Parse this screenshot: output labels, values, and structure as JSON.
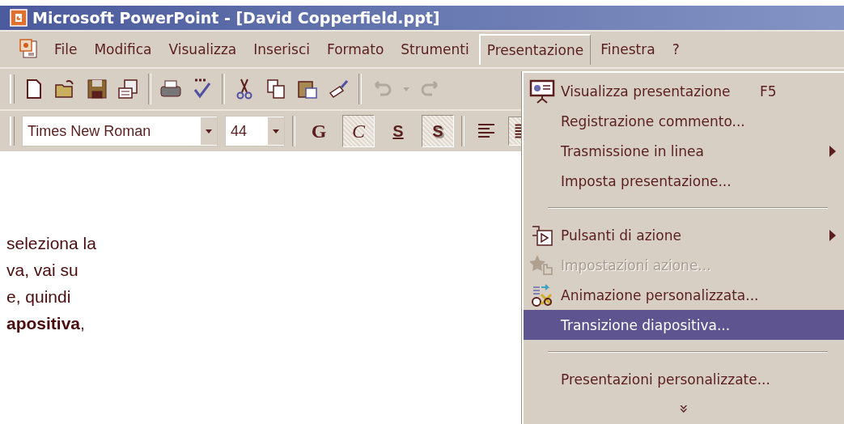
{
  "window": {
    "title": "Microsoft PowerPoint - [David Copperfield.ppt]"
  },
  "menu_bar": [
    {
      "label": "File",
      "selected": false
    },
    {
      "label": "Modifica",
      "selected": false
    },
    {
      "label": "Visualizza",
      "selected": false
    },
    {
      "label": "Inserisci",
      "selected": false
    },
    {
      "label": "Formato",
      "selected": false
    },
    {
      "label": "Strumenti",
      "selected": false
    },
    {
      "label": "Presentazione",
      "selected": true
    },
    {
      "label": "Finestra",
      "selected": false
    },
    {
      "label": "?",
      "selected": false
    }
  ],
  "standard_toolbar": [
    {
      "kind": "new",
      "disabled": false
    },
    {
      "kind": "open",
      "disabled": false
    },
    {
      "kind": "save",
      "disabled": false
    },
    {
      "kind": "mail",
      "disabled": false
    },
    {
      "kind": "separator"
    },
    {
      "kind": "print",
      "disabled": false
    },
    {
      "kind": "spelling",
      "disabled": false
    },
    {
      "kind": "separator"
    },
    {
      "kind": "cut",
      "disabled": false
    },
    {
      "kind": "copy",
      "disabled": false
    },
    {
      "kind": "paste",
      "disabled": false
    },
    {
      "kind": "painter",
      "disabled": false
    },
    {
      "kind": "separator"
    },
    {
      "kind": "undo",
      "disabled": true
    },
    {
      "kind": "dropdown",
      "disabled": true
    },
    {
      "kind": "redo",
      "disabled": true
    }
  ],
  "formatting_toolbar": {
    "font": "Times New Roman",
    "size": "44",
    "buttons": [
      {
        "kind": "bold",
        "label": "G",
        "on": false
      },
      {
        "kind": "italic",
        "label": "C",
        "on": true
      },
      {
        "kind": "underline",
        "label": "S",
        "on": false
      },
      {
        "kind": "shadow",
        "label": "S",
        "on": true
      },
      {
        "kind": "align-left",
        "on": false
      },
      {
        "kind": "align-center",
        "on": true
      }
    ]
  },
  "slide_text": [
    "seleziona la",
    "va, vai su",
    "e, quindi",
    "**apositiva**,"
  ],
  "dropdown_menu": [
    {
      "kind": "item",
      "label": "Visualizza presentazione",
      "shortcut": "F5",
      "submenu": false,
      "disabled": false,
      "selected": false
    },
    {
      "kind": "item",
      "label": "Registrazione commento...",
      "submenu": false,
      "disabled": false,
      "selected": false
    },
    {
      "kind": "item",
      "label": "Trasmissione in linea",
      "submenu": true,
      "disabled": false,
      "selected": false
    },
    {
      "kind": "item",
      "label": "Imposta presentazione...",
      "submenu": false,
      "disabled": false,
      "selected": false
    },
    {
      "kind": "separator"
    },
    {
      "kind": "item",
      "label": "Pulsanti di azione",
      "submenu": true,
      "disabled": false,
      "selected": false
    },
    {
      "kind": "item",
      "label": "Impostazioni azione...",
      "submenu": false,
      "disabled": true,
      "selected": false
    },
    {
      "kind": "item",
      "label": "Animazione personalizzata...",
      "submenu": false,
      "disabled": false,
      "selected": false
    },
    {
      "kind": "item",
      "label": "Transizione diapositiva...",
      "submenu": false,
      "disabled": false,
      "selected": true
    },
    {
      "kind": "separator"
    },
    {
      "kind": "item",
      "label": "Presentazioni personalizzate...",
      "submenu": false,
      "disabled": false,
      "selected": false
    },
    {
      "kind": "more",
      "label": "»"
    }
  ]
}
